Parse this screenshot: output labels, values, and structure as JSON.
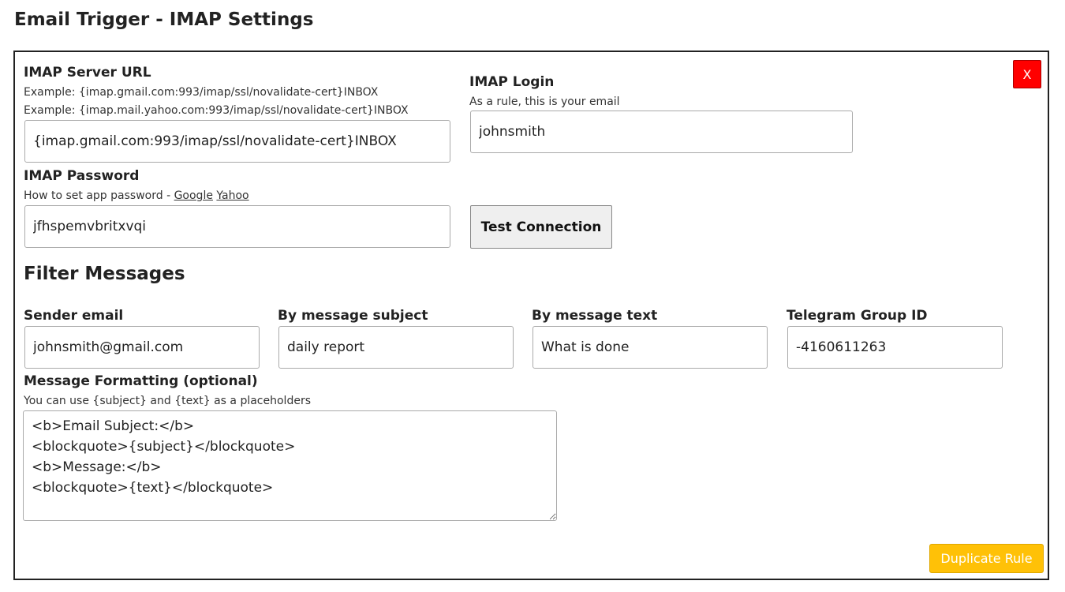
{
  "page": {
    "title": "Email Trigger - IMAP Settings"
  },
  "close_button": {
    "label": "X",
    "color": "#ff0000"
  },
  "imap_server": {
    "label": "IMAP Server URL",
    "example1": "Example: {imap.gmail.com:993/imap/ssl/novalidate-cert}INBOX",
    "example2": "Example: {imap.mail.yahoo.com:993/imap/ssl/novalidate-cert}INBOX",
    "value": "{imap.gmail.com:993/imap/ssl/novalidate-cert}INBOX"
  },
  "imap_login": {
    "label": "IMAP Login",
    "hint": "As a rule, this is your email",
    "value": "johnsmith"
  },
  "imap_password": {
    "label": "IMAP Password",
    "hint_prefix": "How to set app password - ",
    "link_google": "Google",
    "link_yahoo": "Yahoo",
    "value": "jfhspemvbritxvqi"
  },
  "test_button": {
    "label": "Test Connection"
  },
  "filter": {
    "title": "Filter Messages",
    "sender": {
      "label": "Sender email",
      "value": "johnsmith@gmail.com"
    },
    "subject": {
      "label": "By message subject",
      "value": "daily report"
    },
    "text": {
      "label": "By message text",
      "value": "What is done"
    },
    "telegram": {
      "label": "Telegram Group ID",
      "value": "-4160611263"
    }
  },
  "formatting": {
    "label": "Message Formatting (optional)",
    "hint": "You can use {subject} and {text} as a placeholders",
    "value": "<b>Email Subject:</b>\n<blockquote>{subject}</blockquote>\n<b>Message:</b>\n<blockquote>{text}</blockquote>"
  },
  "duplicate_button": {
    "label": "Duplicate Rule",
    "color": "#ffc107"
  }
}
